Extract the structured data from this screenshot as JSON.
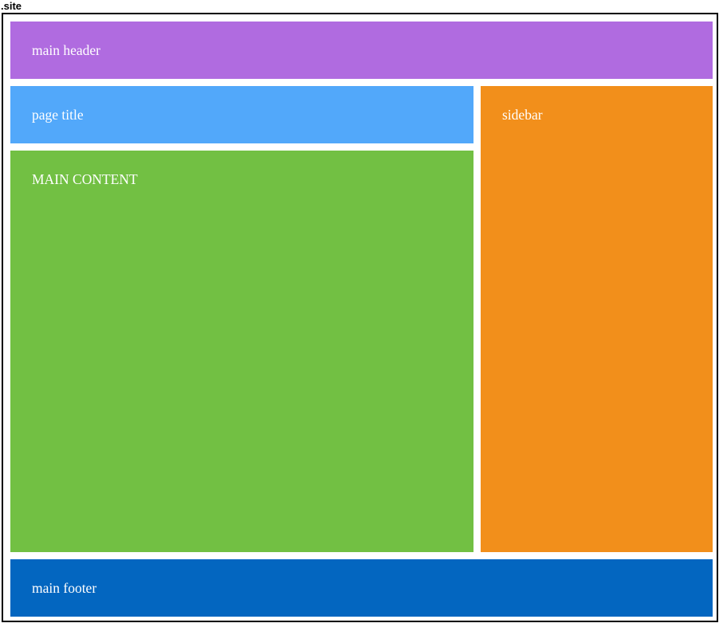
{
  "caption": ".site",
  "layout": {
    "header": {
      "label": "main header",
      "color": "#b06be0"
    },
    "title": {
      "label": "page title",
      "color": "#52a8fa"
    },
    "sidebar": {
      "label": "sidebar",
      "color": "#f28f1b"
    },
    "content": {
      "label": "MAIN CONTENT",
      "color": "#72c043"
    },
    "footer": {
      "label": "main footer",
      "color": "#0366c0"
    }
  }
}
